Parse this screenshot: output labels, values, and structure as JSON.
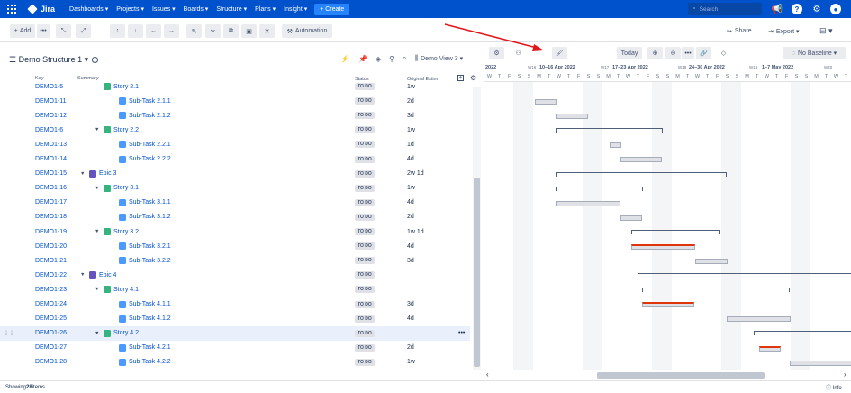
{
  "nav": {
    "brand": "Jira",
    "items": [
      "Dashboards ▾",
      "Projects ▾",
      "Issues ▾",
      "Boards ▾",
      "Structure ▾",
      "Plans ▾",
      "Insight ▾"
    ],
    "create": "+ Create",
    "search_placeholder": "Search"
  },
  "toolbar": {
    "add": "Add",
    "automation": "Automation",
    "share": "Share",
    "export": "Export ▾"
  },
  "structure": {
    "title": "Demo Structure 1 ▾",
    "view": "Demo View 3 ▾",
    "columns": {
      "key": "Key",
      "summary": "Summary",
      "status": "Status",
      "estimate": "Original Estim"
    }
  },
  "rows": [
    {
      "key": "DEMO1-5",
      "type": "story",
      "summary": "Story 2.1",
      "level": 2,
      "status": "TO DO",
      "est": "1w",
      "caret": false
    },
    {
      "key": "DEMO1-11",
      "type": "sub",
      "summary": "Sub-Task 2.1.1",
      "level": 3,
      "status": "TO DO",
      "est": "2d",
      "caret": false
    },
    {
      "key": "DEMO1-12",
      "type": "sub",
      "summary": "Sub-Task 2.1.2",
      "level": 3,
      "status": "TO DO",
      "est": "3d",
      "caret": false
    },
    {
      "key": "DEMO1-6",
      "type": "story",
      "summary": "Story 2.2",
      "level": 2,
      "status": "TO DO",
      "est": "1w",
      "caret": true
    },
    {
      "key": "DEMO1-13",
      "type": "sub",
      "summary": "Sub-Task 2.2.1",
      "level": 3,
      "status": "TO DO",
      "est": "1d",
      "caret": false
    },
    {
      "key": "DEMO1-14",
      "type": "sub",
      "summary": "Sub-Task 2.2.2",
      "level": 3,
      "status": "TO DO",
      "est": "4d",
      "caret": false
    },
    {
      "key": "DEMO1-15",
      "type": "epic",
      "summary": "Epic 3",
      "level": 1,
      "status": "TO DO",
      "est": "2w 1d",
      "caret": true
    },
    {
      "key": "DEMO1-16",
      "type": "story",
      "summary": "Story 3.1",
      "level": 2,
      "status": "TO DO",
      "est": "1w",
      "caret": true
    },
    {
      "key": "DEMO1-17",
      "type": "sub",
      "summary": "Sub-Task 3.1.1",
      "level": 3,
      "status": "TO DO",
      "est": "4d",
      "caret": false
    },
    {
      "key": "DEMO1-18",
      "type": "sub",
      "summary": "Sub-Task 3.1.2",
      "level": 3,
      "status": "TO DO",
      "est": "2d",
      "caret": false
    },
    {
      "key": "DEMO1-19",
      "type": "story",
      "summary": "Story 3.2",
      "level": 2,
      "status": "TO DO",
      "est": "1w 1d",
      "caret": true
    },
    {
      "key": "DEMO1-20",
      "type": "sub",
      "summary": "Sub-Task 3.2.1",
      "level": 3,
      "status": "TO DO",
      "est": "4d",
      "caret": false
    },
    {
      "key": "DEMO1-21",
      "type": "sub",
      "summary": "Sub-Task 3.2.2",
      "level": 3,
      "status": "TO DO",
      "est": "3d",
      "caret": false
    },
    {
      "key": "DEMO1-22",
      "type": "epic",
      "summary": "Epic 4",
      "level": 1,
      "status": "TO DO",
      "est": "",
      "caret": true
    },
    {
      "key": "DEMO1-23",
      "type": "story",
      "summary": "Story 4.1",
      "level": 2,
      "status": "TO DO",
      "est": "",
      "caret": true
    },
    {
      "key": "DEMO1-24",
      "type": "sub",
      "summary": "Sub-Task 4.1.1",
      "level": 3,
      "status": "TO DO",
      "est": "3d",
      "caret": false
    },
    {
      "key": "DEMO1-25",
      "type": "sub",
      "summary": "Sub-Task 4.1.2",
      "level": 3,
      "status": "TO DO",
      "est": "4d",
      "caret": false
    },
    {
      "key": "DEMO1-26",
      "type": "story",
      "summary": "Story 4.2",
      "level": 2,
      "status": "TO DO",
      "est": "",
      "caret": true
    },
    {
      "key": "DEMO1-27",
      "type": "sub",
      "summary": "Sub-Task 4.2.1",
      "level": 3,
      "status": "TO DO",
      "est": "2d",
      "caret": false
    },
    {
      "key": "DEMO1-28",
      "type": "sub",
      "summary": "Sub-Task 4.2.2",
      "level": 3,
      "status": "TO DO",
      "est": "1w",
      "caret": false
    }
  ],
  "gantt": {
    "today": "Today",
    "baseline": "No Baseline ▾",
    "year": "2022",
    "weeks": [
      "W16",
      "10–16 Apr 2022",
      "W17",
      "17–23 Apr 2022",
      "W18",
      "24–30 Apr 2022",
      "W18",
      "1–7 May 2022",
      "W20"
    ],
    "days": [
      "W",
      "T",
      "F",
      "S",
      "S",
      "M",
      "T",
      "W",
      "T",
      "F",
      "S",
      "S",
      "M",
      "T",
      "W",
      "T",
      "F",
      "S",
      "S",
      "M",
      "T",
      "W",
      "T",
      "F",
      "S",
      "S",
      "M",
      "T",
      "W",
      "T",
      "F",
      "S",
      "S",
      "M",
      "T",
      "W",
      "T"
    ]
  },
  "footer": {
    "prefix": "Showing ",
    "count": "28",
    "suffix": " items",
    "info": "Info"
  }
}
